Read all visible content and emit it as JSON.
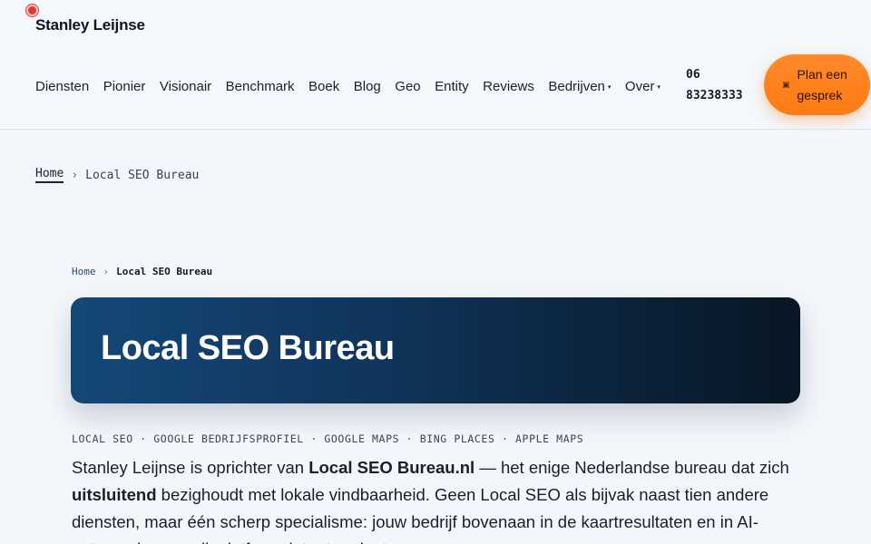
{
  "header": {
    "brand": "Stanley Leijnse",
    "nav": [
      {
        "label": "Diensten",
        "caret": ""
      },
      {
        "label": "Pionier",
        "caret": ""
      },
      {
        "label": "Visionair",
        "caret": ""
      },
      {
        "label": "Benchmark",
        "caret": ""
      },
      {
        "label": "Boek",
        "caret": ""
      },
      {
        "label": "Blog",
        "caret": ""
      },
      {
        "label": "Geo",
        "caret": ""
      },
      {
        "label": "Entity",
        "caret": ""
      },
      {
        "label": "Reviews",
        "caret": ""
      },
      {
        "label": "Bedrijven",
        "caret": "▾"
      },
      {
        "label": "Over",
        "caret": "▾"
      }
    ],
    "phone": "06 83238333",
    "cta_icon": "▣",
    "cta_label": "Plan een gesprek"
  },
  "breadcrumb_top": {
    "home": "Home",
    "sep": "›",
    "current": "Local SEO Bureau"
  },
  "breadcrumb_inner": {
    "home": "Home",
    "sep": "›",
    "current": "Local SEO Bureau"
  },
  "hero": {
    "title": "Local SEO Bureau"
  },
  "tags": "LOCAL SEO · GOOGLE BEDRIJFSPROFIEL · GOOGLE MAPS · BING PLACES · APPLE MAPS",
  "intro": {
    "p1": "Stanley Leijnse is oprichter van ",
    "b1": "Local SEO Bureau.nl",
    "p2": " — het enige Nederlandse bureau dat zich ",
    "b2": "uitsluitend",
    "p3": " bezighoudt met lokale vindbaarheid. Geen Local SEO als bijvak naast tien andere diensten, maar één scherp specialisme: jouw bedrijf bovenaan in de kaartresultaten en in AI-antwoorden, op elk platform dat ertoe doet."
  },
  "colors": {
    "accent": "#ff7a12",
    "hero_start": "#154878",
    "hero_end": "#081624",
    "record": "#e23a33"
  }
}
